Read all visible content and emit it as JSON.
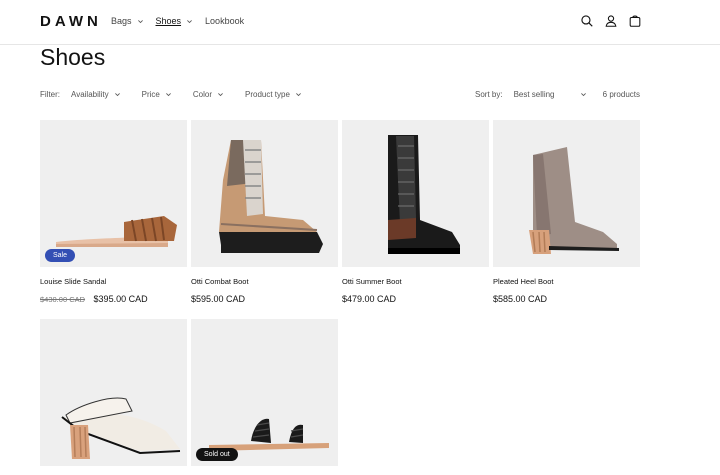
{
  "header": {
    "logo": "DAWN",
    "nav": [
      {
        "label": "Bags",
        "has_dropdown": true,
        "active": false
      },
      {
        "label": "Shoes",
        "has_dropdown": true,
        "active": true
      },
      {
        "label": "Lookbook",
        "has_dropdown": false,
        "active": false
      }
    ],
    "icons": [
      "search-icon",
      "account-icon",
      "cart-icon"
    ]
  },
  "page": {
    "title": "Shoes"
  },
  "filters": {
    "label": "Filter:",
    "items": [
      "Availability",
      "Price",
      "Color",
      "Product type"
    ],
    "sort_label": "Sort by:",
    "sort_value": "Best selling",
    "count": "6 products"
  },
  "products": [
    {
      "name": "Louise Slide Sandal",
      "old_price": "$430.00 CAD",
      "price": "$395.00 CAD",
      "badge": "Sale"
    },
    {
      "name": "Otti Combat Boot",
      "old_price": "",
      "price": "$595.00 CAD",
      "badge": ""
    },
    {
      "name": "Otti Summer Boot",
      "old_price": "",
      "price": "$479.00 CAD",
      "badge": ""
    },
    {
      "name": "Pleated Heel Boot",
      "old_price": "",
      "price": "$585.00 CAD",
      "badge": ""
    },
    {
      "name": "",
      "old_price": "",
      "price": "",
      "badge": ""
    },
    {
      "name": "",
      "old_price": "",
      "price": "",
      "badge": "Sold out"
    }
  ],
  "colors": {
    "text": "#121212",
    "muted": "#555555",
    "sale_badge": "#334fb4",
    "sold_badge": "#121212",
    "card_bg": "#efefef"
  }
}
